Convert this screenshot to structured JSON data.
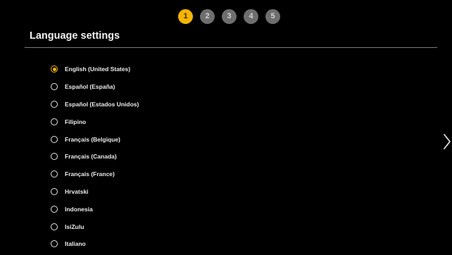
{
  "wizard": {
    "steps": [
      "1",
      "2",
      "3",
      "4",
      "5"
    ],
    "active_step": 1
  },
  "page": {
    "title": "Language settings"
  },
  "languages": [
    {
      "label": "English (United States)",
      "selected": true
    },
    {
      "label": "Español (España)",
      "selected": false
    },
    {
      "label": "Español (Estados Unidos)",
      "selected": false
    },
    {
      "label": "Filipino",
      "selected": false
    },
    {
      "label": "Français (Belgique)",
      "selected": false
    },
    {
      "label": "Français (Canada)",
      "selected": false
    },
    {
      "label": "Français (France)",
      "selected": false
    },
    {
      "label": "Hrvatski",
      "selected": false
    },
    {
      "label": "Indonesia",
      "selected": false
    },
    {
      "label": "IsiZulu",
      "selected": false
    },
    {
      "label": "Italiano",
      "selected": false
    }
  ],
  "navigation": {
    "next_icon": "chevron-right-icon"
  },
  "colors": {
    "background": "#000000",
    "accent": "#f5b400",
    "inactive_step": "#6e6e6e",
    "divider": "#7a7a7a"
  }
}
